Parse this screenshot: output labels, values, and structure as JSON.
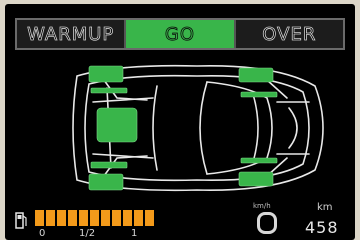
{
  "mode_tabs": [
    {
      "label": "WARMUP",
      "active": false
    },
    {
      "label": "GO",
      "active": true
    },
    {
      "label": "OVER",
      "active": false
    }
  ],
  "fuel_gauge": {
    "labels": [
      "0",
      "1/2",
      "1"
    ],
    "level": 1.0,
    "segments": 11,
    "color": "#f39a1a"
  },
  "speed_unit": "km/h",
  "gear": "O",
  "odometer": {
    "label": "km",
    "value": "458"
  },
  "colors": {
    "accent_green": "#39b54a",
    "background": "#000000",
    "fuel_orange": "#f39a1a"
  },
  "icons": [
    "fuel-pump-icon",
    "car-top-view-icon"
  ]
}
